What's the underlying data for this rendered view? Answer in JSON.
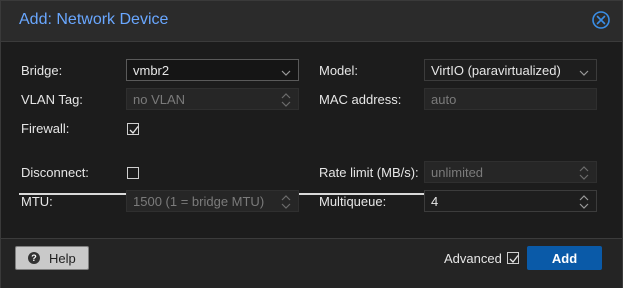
{
  "dialog": {
    "title": "Add: Network Device"
  },
  "fields": {
    "bridge": {
      "label": "Bridge:",
      "value": "vmbr2"
    },
    "vlan_tag": {
      "label": "VLAN Tag:",
      "placeholder": "no VLAN"
    },
    "firewall": {
      "label": "Firewall:",
      "checked": true
    },
    "model": {
      "label": "Model:",
      "value": "VirtIO (paravirtualized)"
    },
    "mac_address": {
      "label": "MAC address:",
      "placeholder": "auto"
    },
    "disconnect": {
      "label": "Disconnect:",
      "checked": false
    },
    "mtu": {
      "label": "MTU:",
      "placeholder": "1500 (1 = bridge MTU)"
    },
    "rate_limit": {
      "label": "Rate limit (MB/s):",
      "placeholder": "unlimited"
    },
    "multiqueue": {
      "label": "Multiqueue:",
      "value": "4"
    }
  },
  "footer": {
    "help_label": "Help",
    "advanced_label": "Advanced",
    "advanced_checked": true,
    "add_label": "Add"
  },
  "colors": {
    "title": "#69a7ff",
    "primary_button": "#0a5aa8"
  }
}
